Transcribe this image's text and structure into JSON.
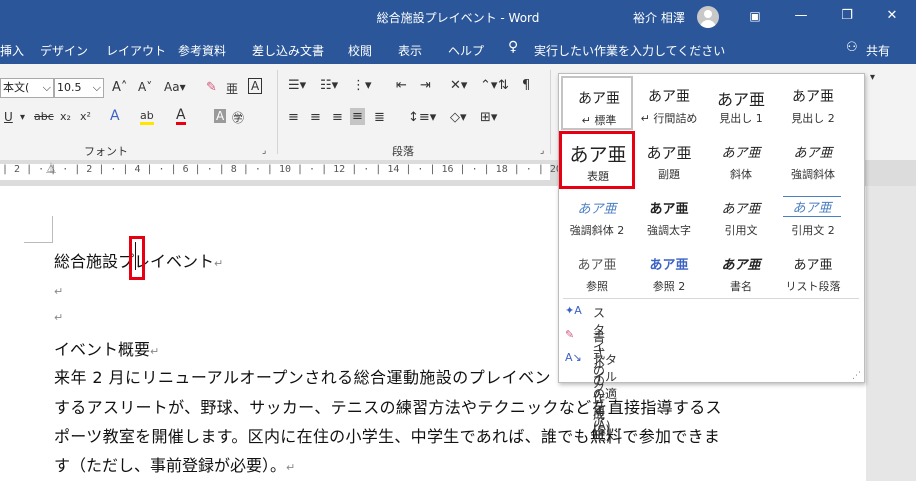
{
  "titlebar": {
    "title": "総合施設プレイベント  -  Word",
    "user": "裕介 相澤",
    "minimize": "—",
    "restore": "❐",
    "close": "✕"
  },
  "menu": {
    "tabs": [
      "挿入",
      "デザイン",
      "レイアウト",
      "参考資料",
      "差し込み文書",
      "校閲",
      "表示",
      "ヘルプ"
    ],
    "tellme": "実行したい作業を入力してください",
    "share": "共有"
  },
  "ribbon": {
    "font_name": "本文(",
    "font_size": "10.5",
    "font_group": "フォント",
    "paragraph_group": "段落"
  },
  "ruler": {
    "ticks": "| 2 | · | · | 2 | · | 4 | · | 6 | · | 8 | · | 10 | · | 12 | · | 14 | · | 16 | · | 18 | · | 20 | · | 22 | · | 24 | · | 26 | · | 28 | · |"
  },
  "document": {
    "title": "総合施設プレイベント",
    "heading": "イベント概要",
    "para1": "来年 2 月にリニューアルオープンされる総合運動施設のプレイベン",
    "para2": "するアスリートが、野球、サッカー、テニスの練習方法やテクニックなどを直接指導するス",
    "para3": "ポーツ教室を開催します。区内に在住の小学生、中学生であれば、誰でも無料で参加できま",
    "para4": "す（ただし、事前登録が必要）。",
    "paragraph_mark": "↵"
  },
  "styles": [
    {
      "sample": "あア亜",
      "name": "↵ 標準"
    },
    {
      "sample": "あア亜",
      "name": "↵ 行間詰め"
    },
    {
      "sample": "あア亜",
      "name": "見出し 1"
    },
    {
      "sample": "あア亜",
      "name": "見出し 2"
    },
    {
      "sample": "あア亜",
      "name": "表題"
    },
    {
      "sample": "あア亜",
      "name": "副題"
    },
    {
      "sample": "あア亜",
      "name": "斜体"
    },
    {
      "sample": "あア亜",
      "name": "強調斜体"
    },
    {
      "sample": "あア亜",
      "name": "強調斜体 2"
    },
    {
      "sample": "あア亜",
      "name": "強調太字"
    },
    {
      "sample": "あア亜",
      "name": "引用文"
    },
    {
      "sample": "あア亜",
      "name": "引用文 2"
    },
    {
      "sample": "あア亜",
      "name": "参照"
    },
    {
      "sample": "あア亜",
      "name": "参照 2"
    },
    {
      "sample": "あア亜",
      "name": "書名"
    },
    {
      "sample": "あア亜",
      "name": "リスト段落"
    }
  ],
  "gallery_commands": [
    {
      "label": "スタイルの作成(S)"
    },
    {
      "label": "書式のクリア(C)"
    },
    {
      "label": "スタイルの適用(A)..."
    }
  ],
  "colors": {
    "accent": "#2b579a",
    "highlight": "#e60012"
  }
}
